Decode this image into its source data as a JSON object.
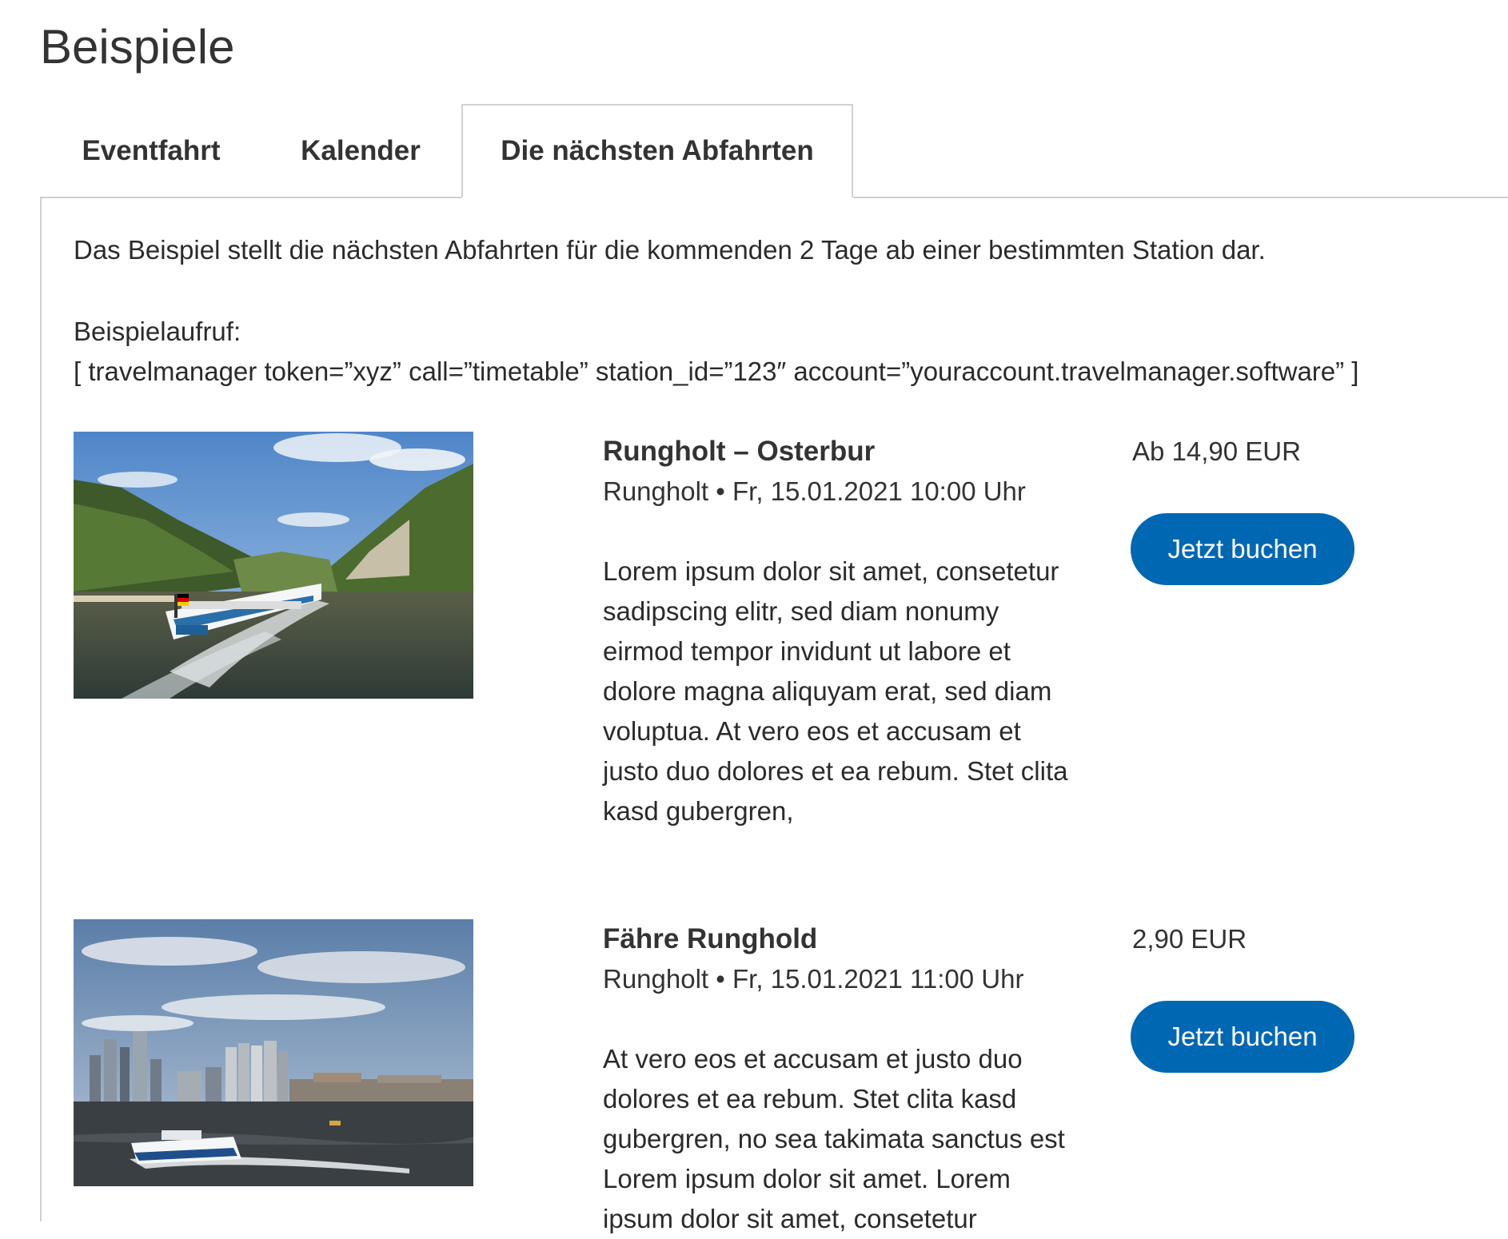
{
  "page": {
    "title": "Beispiele"
  },
  "tabs": [
    {
      "label": "Eventfahrt",
      "active": false
    },
    {
      "label": "Kalender",
      "active": false
    },
    {
      "label": "Die nächsten Abfahrten",
      "active": true
    }
  ],
  "panel": {
    "intro": "Das Beispiel stellt die nächsten Abfahrten für die kommenden 2 Tage ab einer bestimmten Station dar.",
    "call_label": "Beispielaufruf:",
    "call_code": "[ travelmanager token=”xyz” call=”timetable” station_id=”123″ account=”youraccount.travelmanager.software” ]"
  },
  "departures": [
    {
      "title": "Rungholt – Osterbur",
      "meta": "Rungholt • Fr, 15.01.2021 10:00 Uhr",
      "description": "Lorem ipsum dolor sit amet, consetetur sadipscing elitr, sed diam nonumy eirmod tempor invidunt ut labore et dolore magna aliquyam erat, sed diam voluptua. At vero eos et accusam et justo duo dolores et ea rebum. Stet clita kasd gubergren,",
      "price": "Ab 14,90 EUR",
      "button": "Jetzt buchen",
      "image": "river-boat-photo"
    },
    {
      "title": "Fähre Runghold",
      "meta": "Rungholt • Fr, 15.01.2021 11:00 Uhr",
      "description": "At vero eos et accusam et justo duo dolores et ea rebum. Stet clita kasd gubergren, no sea takimata sanctus est Lorem ipsum dolor sit amet. Lorem ipsum dolor sit amet, consetetur",
      "price": "2,90 EUR",
      "button": "Jetzt buchen",
      "image": "harbor-ferry-photo"
    }
  ]
}
